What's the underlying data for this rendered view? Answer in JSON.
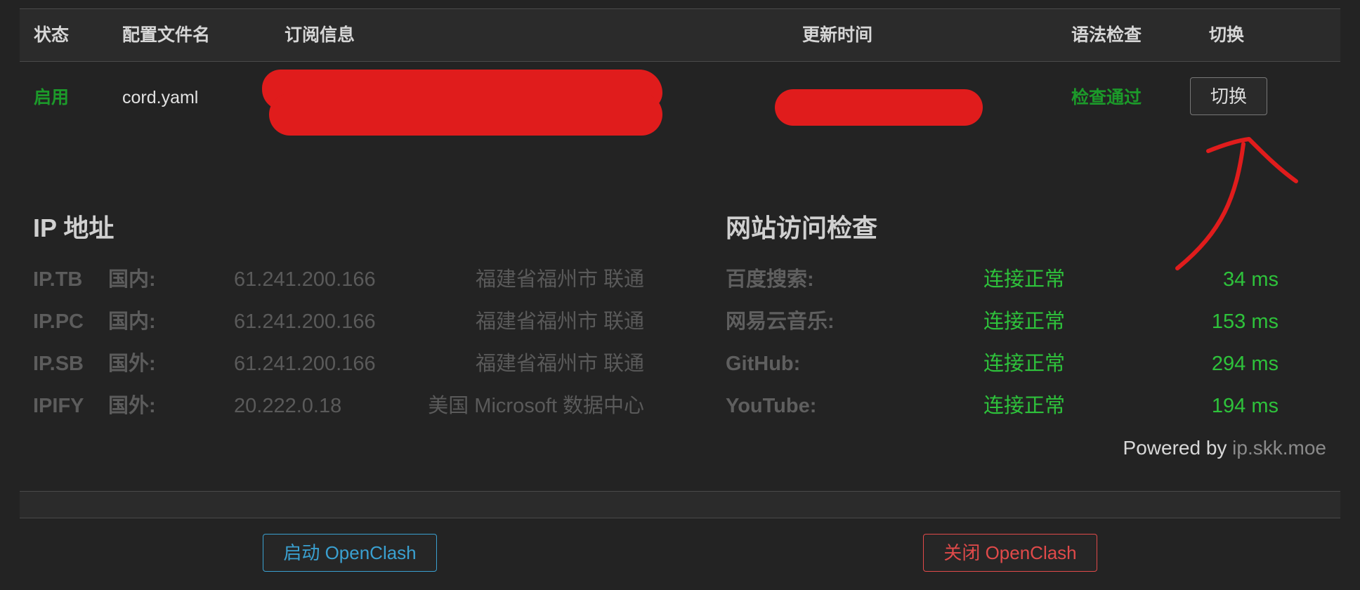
{
  "config_table": {
    "headers": {
      "status": "状态",
      "filename": "配置文件名",
      "subscription": "订阅信息",
      "update_time": "更新时间",
      "syntax_check": "语法检查",
      "switch": "切换"
    },
    "row": {
      "status": "启用",
      "filename": "cord.yaml",
      "syntax_check": "检查通过",
      "switch_label": "切换"
    }
  },
  "ip_section": {
    "title": "IP 地址",
    "rows": [
      {
        "name": "IP.TB",
        "region": "国内:",
        "ip": "61.241.200.166",
        "location": "福建省福州市 联通"
      },
      {
        "name": "IP.PC",
        "region": "国内:",
        "ip": "61.241.200.166",
        "location": "福建省福州市 联通"
      },
      {
        "name": "IP.SB",
        "region": "国外:",
        "ip": "61.241.200.166",
        "location": "福建省福州市 联通"
      },
      {
        "name": "IPIFY",
        "region": "国外:",
        "ip": "20.222.0.18",
        "location": "美国 Microsoft 数据中心"
      }
    ]
  },
  "web_section": {
    "title": "网站访问检查",
    "rows": [
      {
        "name": "百度搜索:",
        "status": "连接正常",
        "latency": "34 ms"
      },
      {
        "name": "网易云音乐:",
        "status": "连接正常",
        "latency": "153 ms"
      },
      {
        "name": "GitHub:",
        "status": "连接正常",
        "latency": "294 ms"
      },
      {
        "name": "YouTube:",
        "status": "连接正常",
        "latency": "194 ms"
      }
    ]
  },
  "powered": {
    "prefix": "Powered by ",
    "link": "ip.skk.moe"
  },
  "actions": {
    "start": "启动 OpenClash",
    "stop": "关闭 OpenClash"
  },
  "colors": {
    "background": "#232323",
    "ok_green": "#2ec23b",
    "start_blue": "#3aa0d0",
    "stop_red": "#e04a4a",
    "redaction_red": "#e01c1c"
  }
}
